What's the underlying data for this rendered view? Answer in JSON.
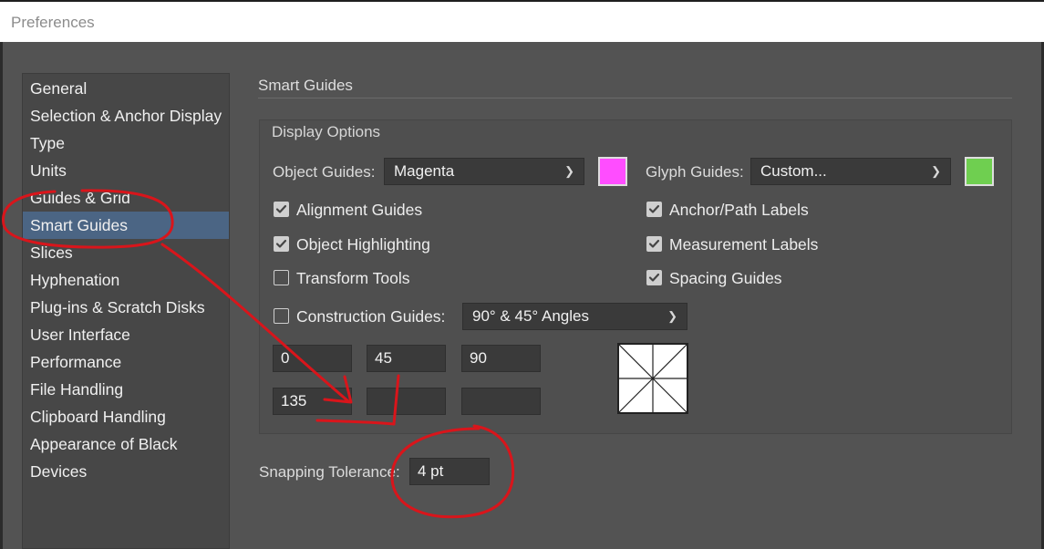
{
  "window": {
    "title": "Preferences"
  },
  "sidebar": {
    "items": [
      {
        "label": "General",
        "active": false
      },
      {
        "label": "Selection & Anchor Display",
        "active": false
      },
      {
        "label": "Type",
        "active": false
      },
      {
        "label": "Units",
        "active": false
      },
      {
        "label": "Guides & Grid",
        "active": false
      },
      {
        "label": "Smart Guides",
        "active": true
      },
      {
        "label": "Slices",
        "active": false
      },
      {
        "label": "Hyphenation",
        "active": false
      },
      {
        "label": "Plug-ins & Scratch Disks",
        "active": false
      },
      {
        "label": "User Interface",
        "active": false
      },
      {
        "label": "Performance",
        "active": false
      },
      {
        "label": "File Handling",
        "active": false
      },
      {
        "label": "Clipboard Handling",
        "active": false
      },
      {
        "label": "Appearance of Black",
        "active": false
      },
      {
        "label": "Devices",
        "active": false
      }
    ]
  },
  "main": {
    "section_title": "Smart Guides",
    "display_options": {
      "title": "Display Options",
      "object_guides": {
        "label": "Object Guides:",
        "value": "Magenta",
        "color": "#ff4dff"
      },
      "glyph_guides": {
        "label": "Glyph Guides:",
        "value": "Custom...",
        "color": "#6fcf50"
      },
      "checkboxes_left": [
        {
          "label": "Alignment Guides",
          "checked": true
        },
        {
          "label": "Object Highlighting",
          "checked": true
        },
        {
          "label": "Transform Tools",
          "checked": false
        }
      ],
      "checkboxes_right": [
        {
          "label": "Anchor/Path Labels",
          "checked": true
        },
        {
          "label": "Measurement Labels",
          "checked": true
        },
        {
          "label": "Spacing Guides",
          "checked": true
        }
      ],
      "construction_guides": {
        "label": "Construction Guides:",
        "checked": false,
        "value": "90° & 45° Angles",
        "angles": [
          "0",
          "45",
          "90",
          "135",
          "",
          ""
        ]
      }
    },
    "snapping_tolerance": {
      "label": "Snapping Tolerance:",
      "value": "4 pt"
    }
  },
  "colors": {
    "annotation": "#d9151b",
    "selection": "#4b6584"
  }
}
